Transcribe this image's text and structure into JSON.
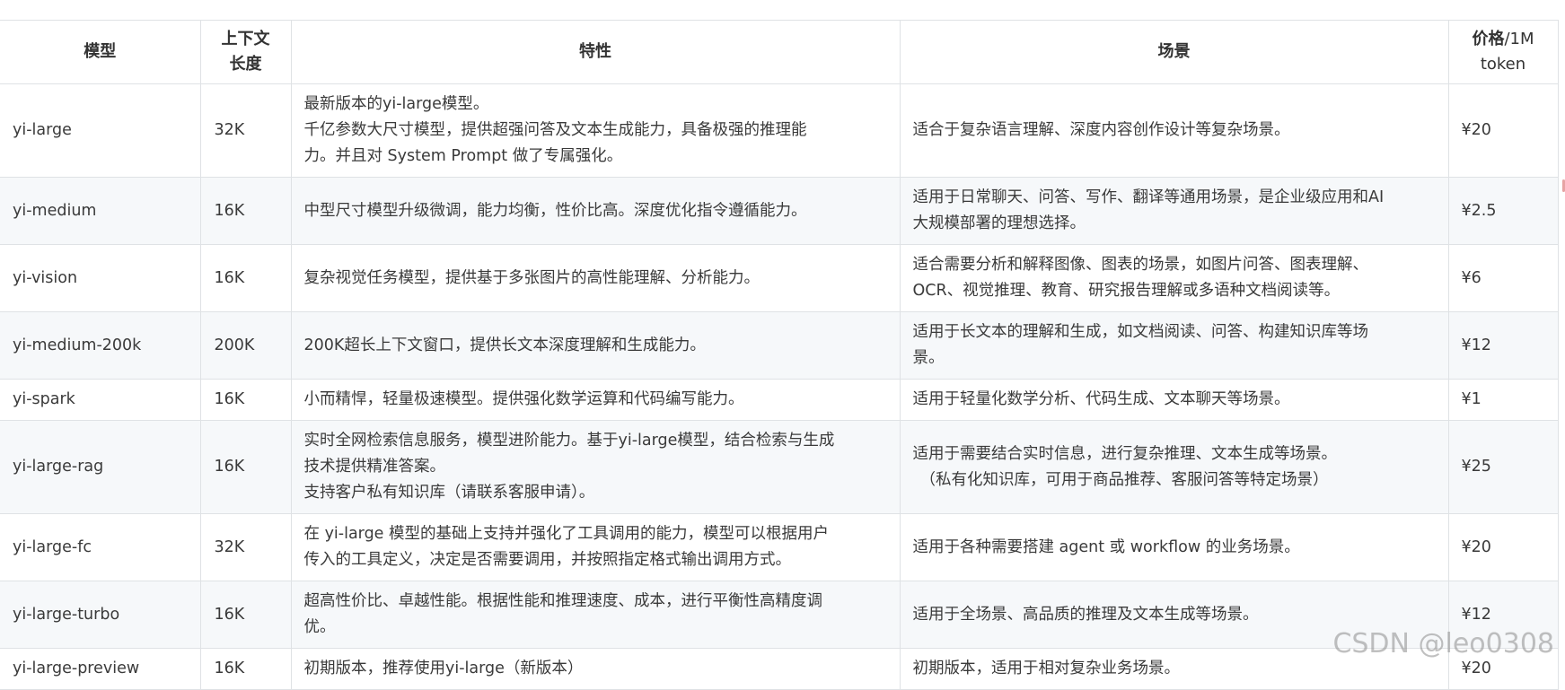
{
  "headers": {
    "model": "模型",
    "context_line1": "上下文",
    "context_line2": "长度",
    "features": "特性",
    "scenarios": "场景",
    "price_bold": "价格",
    "price_suffix": "/1M",
    "price_line2": "token"
  },
  "rows": [
    {
      "model": "yi-large",
      "context": "32K",
      "features": [
        "最新版本的yi-large模型。",
        "千亿参数大尺寸模型，提供超强问答及文本生成能力，具备极强的推理能",
        "力。并且对 System Prompt 做了专属强化。"
      ],
      "scenarios": [
        "适合于复杂语言理解、深度内容创作设计等复杂场景。"
      ],
      "price": "¥20"
    },
    {
      "model": "yi-medium",
      "context": "16K",
      "features": [
        "中型尺寸模型升级微调，能力均衡，性价比高。深度优化指令遵循能力。"
      ],
      "scenarios": [
        "适用于日常聊天、问答、写作、翻译等通用场景，是企业级应用和AI",
        "大规模部署的理想选择。"
      ],
      "price": "¥2.5"
    },
    {
      "model": "yi-vision",
      "context": "16K",
      "features": [
        "复杂视觉任务模型，提供基于多张图片的高性能理解、分析能力。"
      ],
      "scenarios": [
        "适合需要分析和解释图像、图表的场景，如图片问答、图表理解、",
        "OCR、视觉推理、教育、研究报告理解或多语种文档阅读等。"
      ],
      "price": "¥6"
    },
    {
      "model": "yi-medium-200k",
      "context": "200K",
      "features": [
        "200K超长上下文窗口，提供长文本深度理解和生成能力。"
      ],
      "scenarios": [
        "适用于长文本的理解和生成，如文档阅读、问答、构建知识库等场",
        "景。"
      ],
      "price": "¥12"
    },
    {
      "model": "yi-spark",
      "context": "16K",
      "features": [
        "小而精悍，轻量极速模型。提供强化数学运算和代码编写能力。"
      ],
      "scenarios": [
        "适用于轻量化数学分析、代码生成、文本聊天等场景。"
      ],
      "price": "¥1"
    },
    {
      "model": "yi-large-rag",
      "context": "16K",
      "features": [
        "实时全网检索信息服务，模型进阶能力。基于yi-large模型，结合检索与生成",
        "技术提供精准答案。",
        "支持客户私有知识库（请联系客服申请）。"
      ],
      "scenarios": [
        "适用于需要结合实时信息，进行复杂推理、文本生成等场景。",
        "（私有化知识库，可用于商品推荐、客服问答等特定场景）"
      ],
      "price": "¥25"
    },
    {
      "model": "yi-large-fc",
      "context": "32K",
      "features": [
        "在 yi-large 模型的基础上支持并强化了工具调用的能力，模型可以根据用户",
        "传入的工具定义，决定是否需要调用，并按照指定格式输出调用方式。"
      ],
      "scenarios": [
        "适用于各种需要搭建 agent 或 workflow 的业务场景。"
      ],
      "price": "¥20"
    },
    {
      "model": "yi-large-turbo",
      "context": "16K",
      "features": [
        "超高性价比、卓越性能。根据性能和推理速度、成本，进行平衡性高精度调",
        "优。"
      ],
      "scenarios": [
        "适用于全场景、高品质的推理及文本生成等场景。"
      ],
      "price": "¥12"
    },
    {
      "model": "yi-large-preview",
      "context": "16K",
      "features": [
        "初期版本，推荐使用yi-large（新版本）"
      ],
      "scenarios": [
        "初期版本，适用于相对复杂业务场景。"
      ],
      "price": "¥20"
    }
  ],
  "watermark": "CSDN @leo0308"
}
